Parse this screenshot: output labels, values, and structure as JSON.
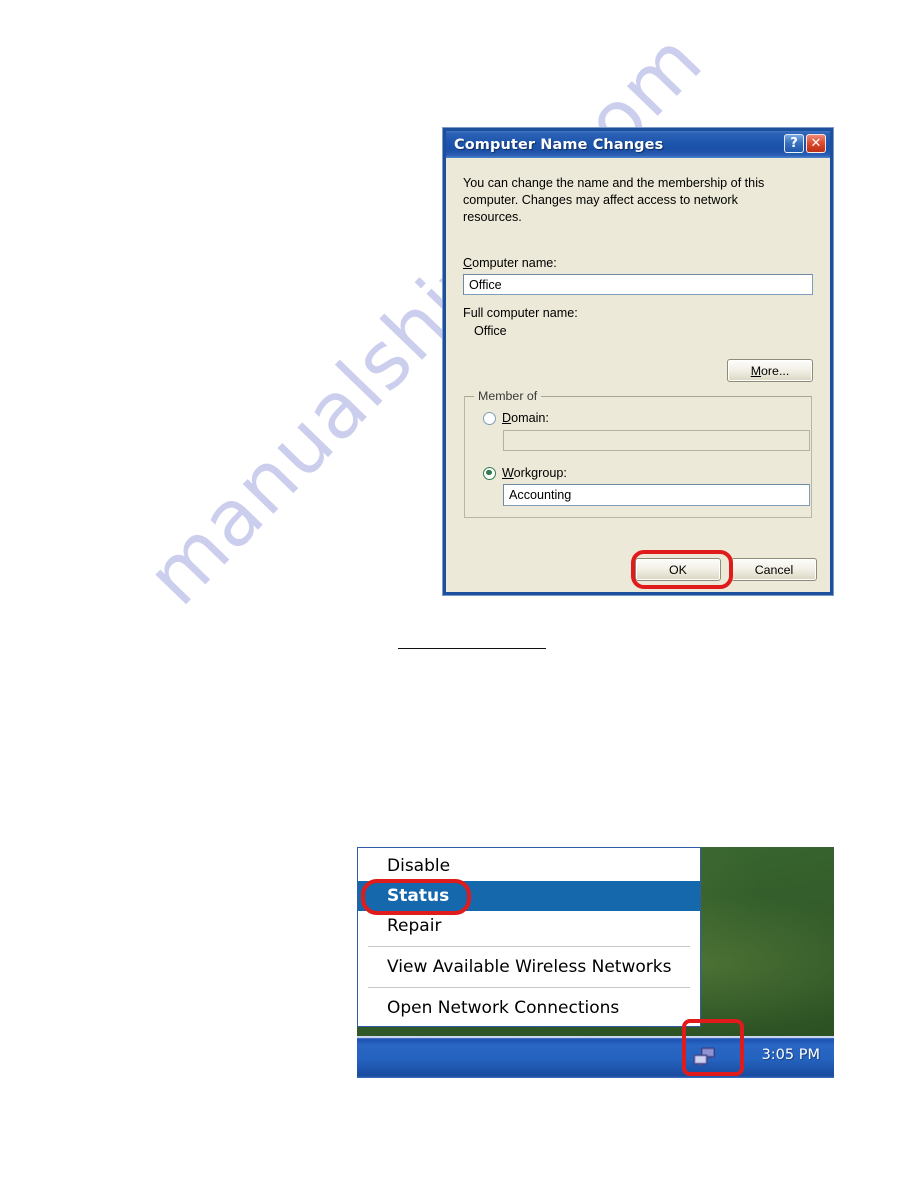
{
  "page": {
    "watermark": "manualshive . com",
    "rule_present": true
  },
  "dialog": {
    "title": "Computer Name Changes",
    "titlebar_buttons": [
      {
        "name": "help-button",
        "glyph": "?"
      },
      {
        "name": "close-button",
        "glyph": "✕"
      }
    ],
    "intro_text": "You can change the name and the membership of this computer. Changes may affect access to network resources.",
    "computer_name": {
      "label_accel": "C",
      "label_rest": "omputer name:",
      "value": "Office"
    },
    "full_computer_name": {
      "label": "Full computer name:",
      "value": "Office"
    },
    "more_button": {
      "accel": "M",
      "rest": "ore..."
    },
    "member_of": {
      "legend": "Member of",
      "domain": {
        "accel": "D",
        "rest": "omain:",
        "selected": false,
        "value": ""
      },
      "workgroup": {
        "accel": "W",
        "rest": "orkgroup:",
        "selected": true,
        "value": "Accounting"
      }
    },
    "ok_label": "OK",
    "cancel_label": "Cancel",
    "annotations": {
      "ok_highlight_color": "#e01b1b"
    }
  },
  "tray_screenshot": {
    "context_menu": {
      "items": [
        {
          "label": "Disable",
          "highlighted": false,
          "separator_after": false
        },
        {
          "label": "Status",
          "highlighted": true,
          "separator_after": false
        },
        {
          "label": "Repair",
          "highlighted": false,
          "separator_after": true
        },
        {
          "label": "View Available Wireless Networks",
          "highlighted": false,
          "separator_after": true
        },
        {
          "label": "Open Network Connections",
          "highlighted": false,
          "separator_after": false
        }
      ]
    },
    "taskbar": {
      "clock": "3:05 PM",
      "tray_icon": "network-connection-icon"
    },
    "annotations": {
      "status_highlight_color": "#e01b1b",
      "tray_icon_highlight_color": "#e01b1b"
    },
    "colors": {
      "menu_highlight": "#1668ad",
      "taskbar_blue": "#2463bf",
      "desktop_green": "#35602c"
    }
  }
}
